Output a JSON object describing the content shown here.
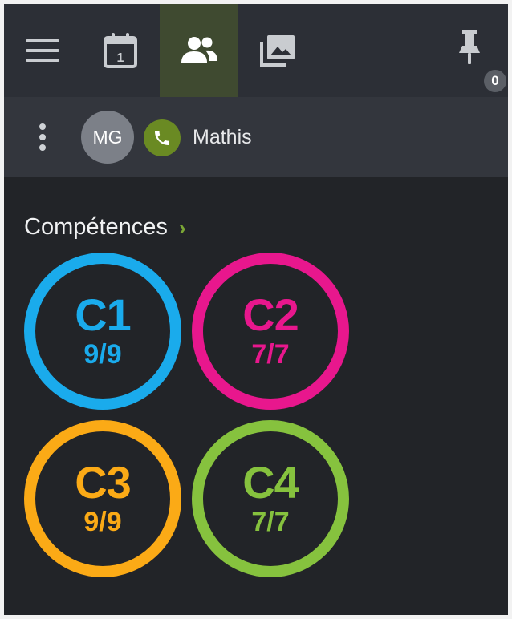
{
  "toolbar": {
    "menu_icon": "hamburger-menu-icon",
    "calendar_icon": "calendar-icon",
    "calendar_day": "1",
    "people_icon": "people-icon",
    "gallery_icon": "gallery-icon",
    "pin_icon": "pin-icon",
    "pin_count": "0",
    "active_tab": "people",
    "active_color": "#3f4a30"
  },
  "contact_bar": {
    "more_icon": "more-vertical-icon",
    "avatar_initials": "MG",
    "call_icon": "phone-icon",
    "call_color": "#6a8a23",
    "name": "Mathis"
  },
  "competences": {
    "title": "Compétences",
    "chevron": "›",
    "chevron_icon": "chevron-right-icon",
    "items": [
      {
        "code": "C1",
        "score": "9/9",
        "color": "#1aabec"
      },
      {
        "code": "C2",
        "score": "7/7",
        "color": "#e8178d"
      },
      {
        "code": "C3",
        "score": "9/9",
        "color": "#fbaa16"
      },
      {
        "code": "C4",
        "score": "7/7",
        "color": "#86c23e"
      }
    ]
  }
}
